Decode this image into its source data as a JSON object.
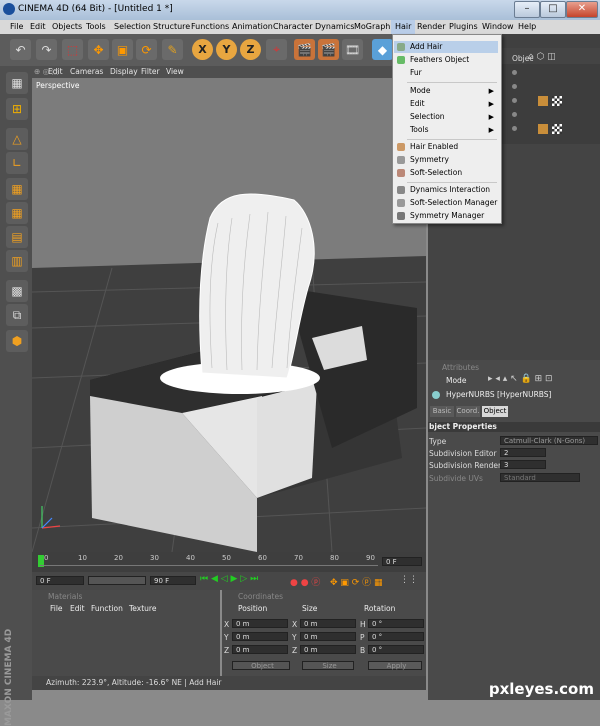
{
  "window": {
    "title": "CINEMA 4D (64 Bit) - [Untitled 1 *]",
    "min": "–",
    "max": "□",
    "close": "✕"
  },
  "menubar": {
    "items": [
      "File",
      "Edit",
      "Objects",
      "Tools",
      "Selection",
      "Structure",
      "Functions",
      "Animation",
      "Character",
      "Dynamics",
      "MoGraph",
      "Hair",
      "Render",
      "Plugins",
      "Window",
      "Help"
    ]
  },
  "viewport": {
    "menu": [
      "Edit",
      "Cameras",
      "Display",
      "Filter",
      "View"
    ],
    "label": "Perspective"
  },
  "hair_menu": {
    "items": [
      {
        "label": "Add Hair",
        "icon": "hair-icon",
        "highlighted": true
      },
      {
        "label": "Feathers Object",
        "icon": "feather-icon"
      },
      {
        "label": "Fur",
        "icon": ""
      },
      {
        "label": "Mode",
        "submenu": true
      },
      {
        "label": "Edit",
        "submenu": true
      },
      {
        "label": "Selection",
        "submenu": true
      },
      {
        "label": "Tools",
        "submenu": true
      },
      {
        "label": "Hair Enabled",
        "icon": "hair-enabled-icon"
      },
      {
        "label": "Symmetry",
        "icon": "symmetry-icon"
      },
      {
        "label": "Soft-Selection",
        "icon": "soft-selection-icon"
      },
      {
        "label": "Dynamics Interaction",
        "icon": "dynamics-icon"
      },
      {
        "label": "Soft-Selection Manager",
        "icon": "soft-selection-manager-icon"
      },
      {
        "label": "Symmetry Manager",
        "icon": "symmetry-manager-icon"
      }
    ]
  },
  "objects_panel": {
    "header": "Objec"
  },
  "attributes": {
    "title": "Attributes",
    "mode": "Mode",
    "object_name": "HyperNURBS [HyperNURBS]",
    "tabs": [
      "Basic",
      "Coord.",
      "Object"
    ],
    "section": "bject Properties",
    "rows": [
      {
        "label": "Type",
        "value": "Catmull-Clark (N-Gons)"
      },
      {
        "label": "Subdivision Editor",
        "value": "2"
      },
      {
        "label": "Subdivision Renderer",
        "value": "3"
      },
      {
        "label": "Subdivide UVs",
        "value": "Standard"
      }
    ]
  },
  "timeline": {
    "ticks": [
      "0",
      "10",
      "20",
      "30",
      "40",
      "50",
      "60",
      "70",
      "80",
      "90"
    ],
    "frame": "0 F"
  },
  "transport": {
    "start": "0 F",
    "end": "90 F"
  },
  "materials": {
    "title": "Materials",
    "menu": [
      "File",
      "Edit",
      "Function",
      "Texture"
    ]
  },
  "coordinates": {
    "title": "Coordinates",
    "headers": [
      "Position",
      "Size",
      "Rotation"
    ],
    "rows": [
      {
        "axis": "X",
        "pos": "0 m",
        "size_axis": "X",
        "size": "0 m",
        "rot_axis": "H",
        "rot": "0 °"
      },
      {
        "axis": "Y",
        "pos": "0 m",
        "size_axis": "Y",
        "size": "0 m",
        "rot_axis": "P",
        "rot": "0 °"
      },
      {
        "axis": "Z",
        "pos": "0 m",
        "size_axis": "Z",
        "size": "0 m",
        "rot_axis": "B",
        "rot": "0 °"
      }
    ],
    "mode_select": "Object",
    "size_select": "Size",
    "apply": "Apply"
  },
  "status": "Azimuth: 223.9°, Altitude: -16.6°  NE  | Add Hair",
  "side_brand": "MAXON CINEMA 4D",
  "watermark": "pxleyes.com"
}
